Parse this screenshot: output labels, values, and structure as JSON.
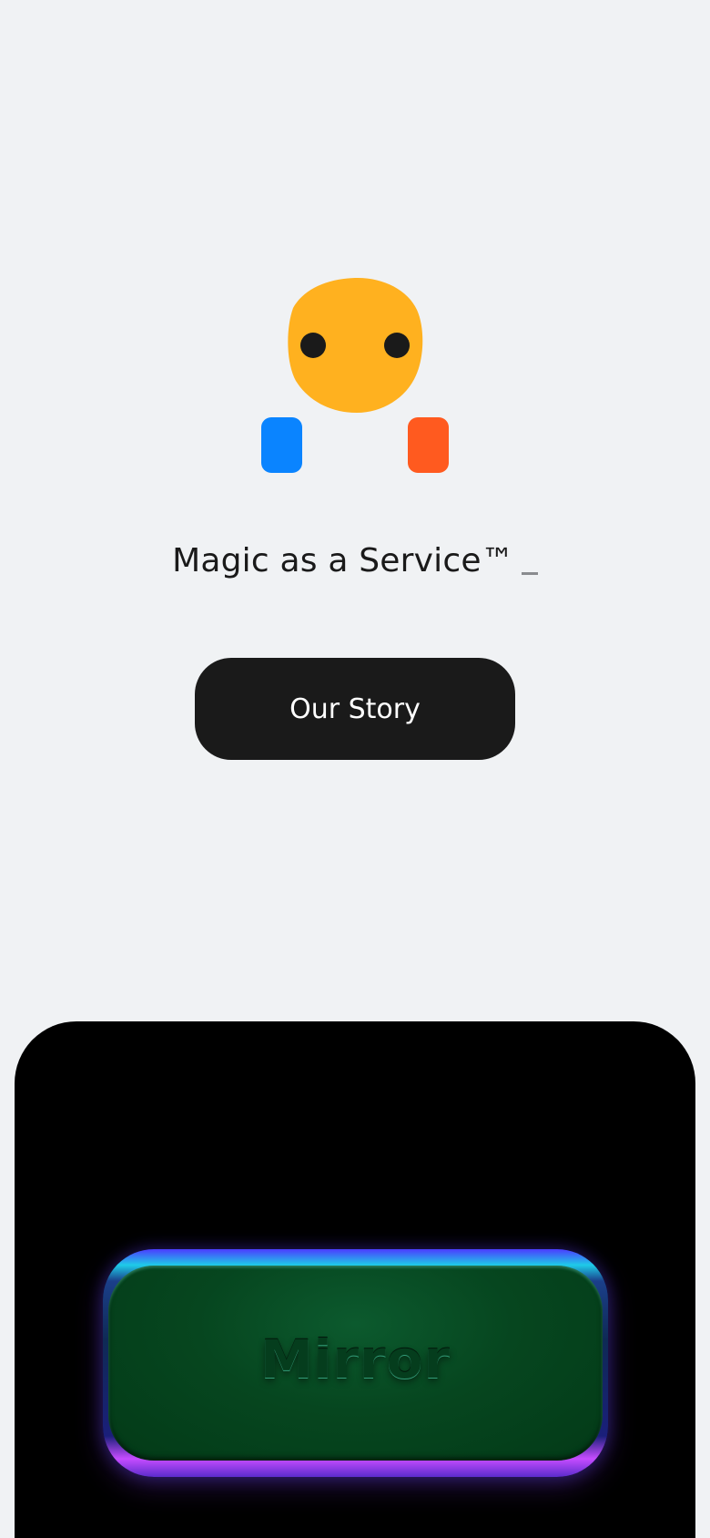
{
  "hero": {
    "tagline": "Magic as a Service™",
    "cta_label": "Our Story"
  },
  "mascot": {
    "face_color": "#ffb11f",
    "eye_color": "#1a1a1a",
    "left_hand_color": "#0a84ff",
    "right_hand_color": "#ff5a1f"
  },
  "showcase": {
    "tile_label": "Mirror",
    "tile_color": "#06461f"
  }
}
